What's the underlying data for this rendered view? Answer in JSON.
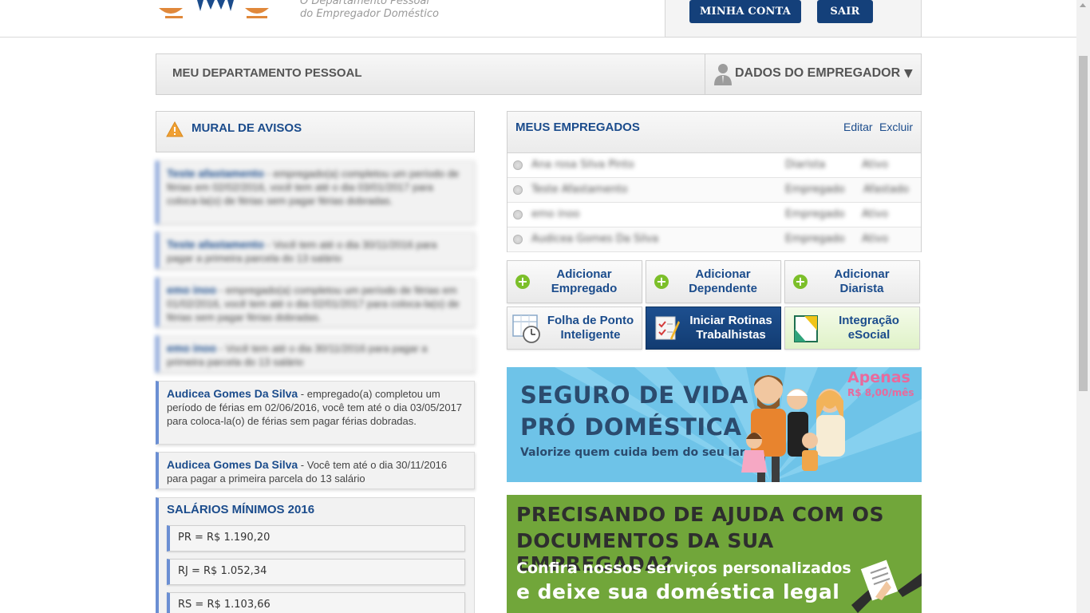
{
  "header": {
    "logo_text_line1": "O Departamento Pessoal",
    "logo_text_line2": "do Empregador Doméstico",
    "minha_conta_label": "MINHA CONTA",
    "sair_label": "SAIR"
  },
  "dept": {
    "title": "MEU DEPARTAMENTO PESSOAL",
    "employer_menu_label": "DADOS DO EMPREGADOR",
    "employer_menu_arrow": "▼"
  },
  "mural": {
    "title": "MURAL DE AVISOS",
    "notices": [
      {
        "name": "Teste afastamento",
        "text": " - empregado(a) completou um período de férias em 02/02/2016, você tem até o dia 03/01/2017 para coloca-la(o) de férias sem pagar férias dobradas."
      },
      {
        "name": "Teste afastamento",
        "text": " - Você tem até o dia 30/11/2016 para pagar a primeira parcela do 13 salário"
      },
      {
        "name": "emo inoo",
        "text": " - empregado(a) completou um período de férias em 01/02/2016, você tem até o dia 02/01/2017 para coloca-la(o) de férias sem pagar férias dobradas."
      },
      {
        "name": "emo inoo",
        "text": " - Você tem até o dia 30/11/2016 para pagar a primeira parcela do 13 salário"
      },
      {
        "name": "Audicea Gomes Da Silva",
        "text": " - empregado(a) completou um período de férias em 02/06/2016, você tem até o dia 03/05/2017 para coloca-la(o) de férias sem pagar férias dobradas."
      },
      {
        "name": "Audicea Gomes Da Silva",
        "text": " - Você tem até o dia 30/11/2016 para pagar a primeira parcela do 13 salário"
      }
    ]
  },
  "salarios": {
    "title": "SALÁRIOS MÍNIMOS 2016",
    "items": [
      "PR = R$ 1.190,20",
      "RJ = R$ 1.052,34",
      "RS = R$ 1.103,66"
    ]
  },
  "employees": {
    "title": "MEUS EMPREGADOS",
    "edit_label": "Editar",
    "delete_label": "Excluir",
    "rows": [
      {
        "name": "Ana rosa Silva Pinto",
        "type": "Diarista",
        "status": "Ativo"
      },
      {
        "name": "Teste Afastamento",
        "type": "Empregado",
        "status": "Afastado"
      },
      {
        "name": "emo inoo",
        "type": "Empregado",
        "status": "Ativo"
      },
      {
        "name": "Audicea Gomes Da Silva",
        "type": "Empregado",
        "status": "Ativo"
      }
    ]
  },
  "actions": {
    "add_employee": "Adicionar Empregado",
    "add_dependent": "Adicionar Dependente",
    "add_diarist": "Adicionar Diarista",
    "folha_ponto": "Folha de Ponto Inteligente",
    "rotinas": "Iniciar Rotinas Trabalhistas",
    "esocial": "Integração eSocial"
  },
  "banner_seguro": {
    "line1": "SEGURO DE VIDA",
    "line2": "PRÓ DOMÉSTICA",
    "line3": "Valorize quem cuida bem do seu lar",
    "apenas": "Apenas",
    "price": "R$ 8,00/mês"
  },
  "banner_ajuda": {
    "line1": "PRECISANDO DE AJUDA COM OS",
    "line2": "DOCUMENTOS DA SUA EMPREGADA?",
    "line3": "Confira nossos serviços personalizados",
    "line4": "e deixe sua doméstica legal"
  },
  "colors": {
    "brand_blue": "#14407a",
    "link_blue": "#1b4c8c",
    "accent_green": "#7cbf2a",
    "notice_border": "#6b8fd3"
  }
}
